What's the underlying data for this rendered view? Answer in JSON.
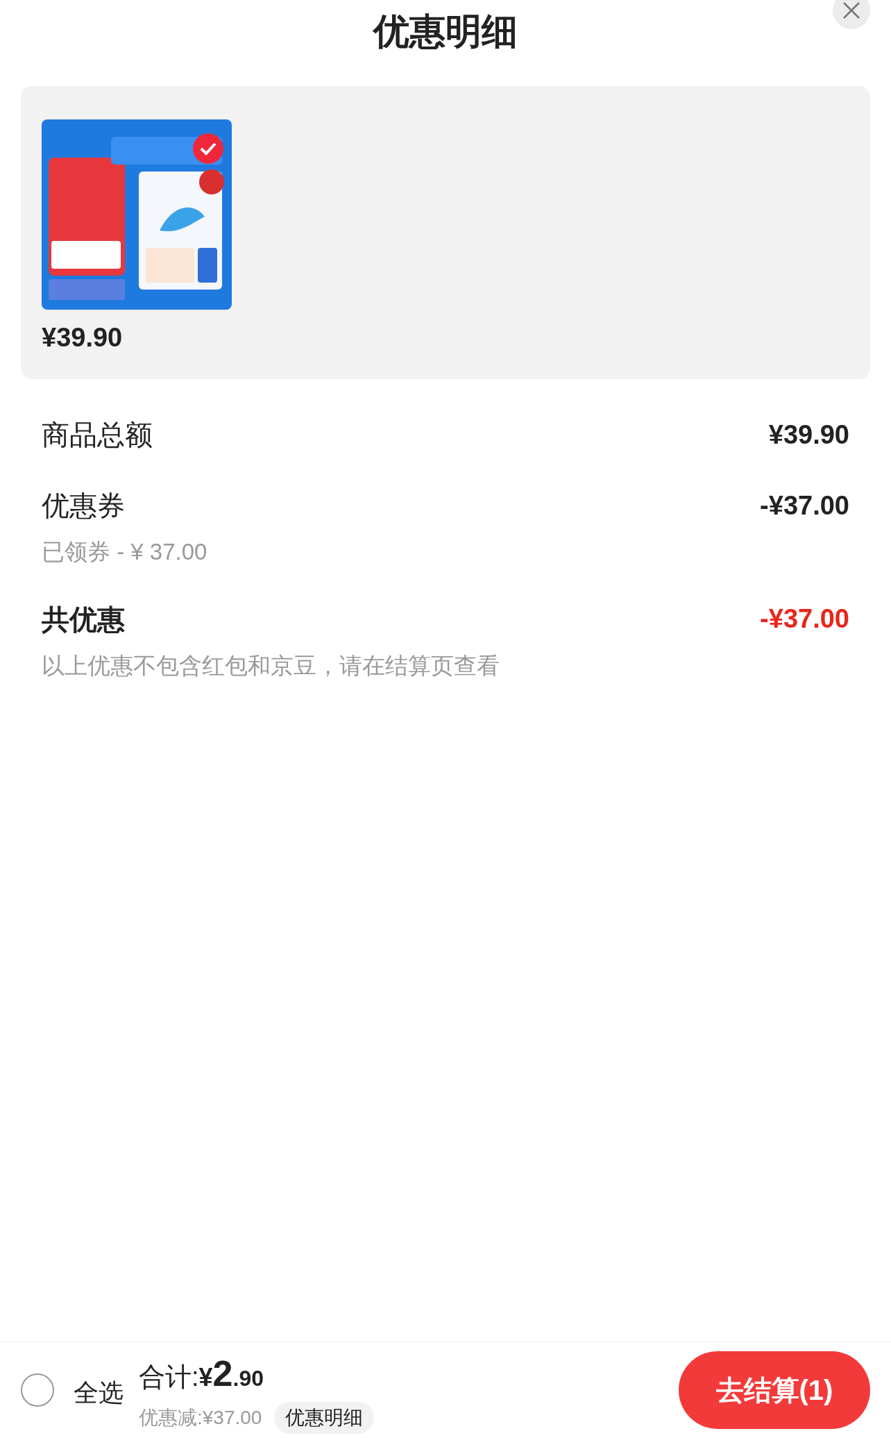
{
  "title": "优惠明细",
  "product": {
    "kind": "picture",
    "selected": true,
    "price": "¥39.90"
  },
  "rows": [
    {
      "kind": "normal",
      "label": "商品总额",
      "value": "¥39.90"
    },
    {
      "kind": "normal",
      "label": "优惠券",
      "value": "-¥37.00",
      "note": "已领券 - ¥ 37.00"
    },
    {
      "kind": "total",
      "label": "共优惠",
      "value": "-¥37.00",
      "note": "以上优惠不包含红包和京豆，请在结算页查看"
    }
  ],
  "footer": {
    "select_all": {
      "label": "全选",
      "checked": false
    },
    "total_label": "合计:",
    "currency": "¥",
    "total_int": "2",
    "total_dec": ".90",
    "discount": "优惠减:¥37.00",
    "detail_button": "优惠明细",
    "checkout_button": "去结算(1)"
  }
}
